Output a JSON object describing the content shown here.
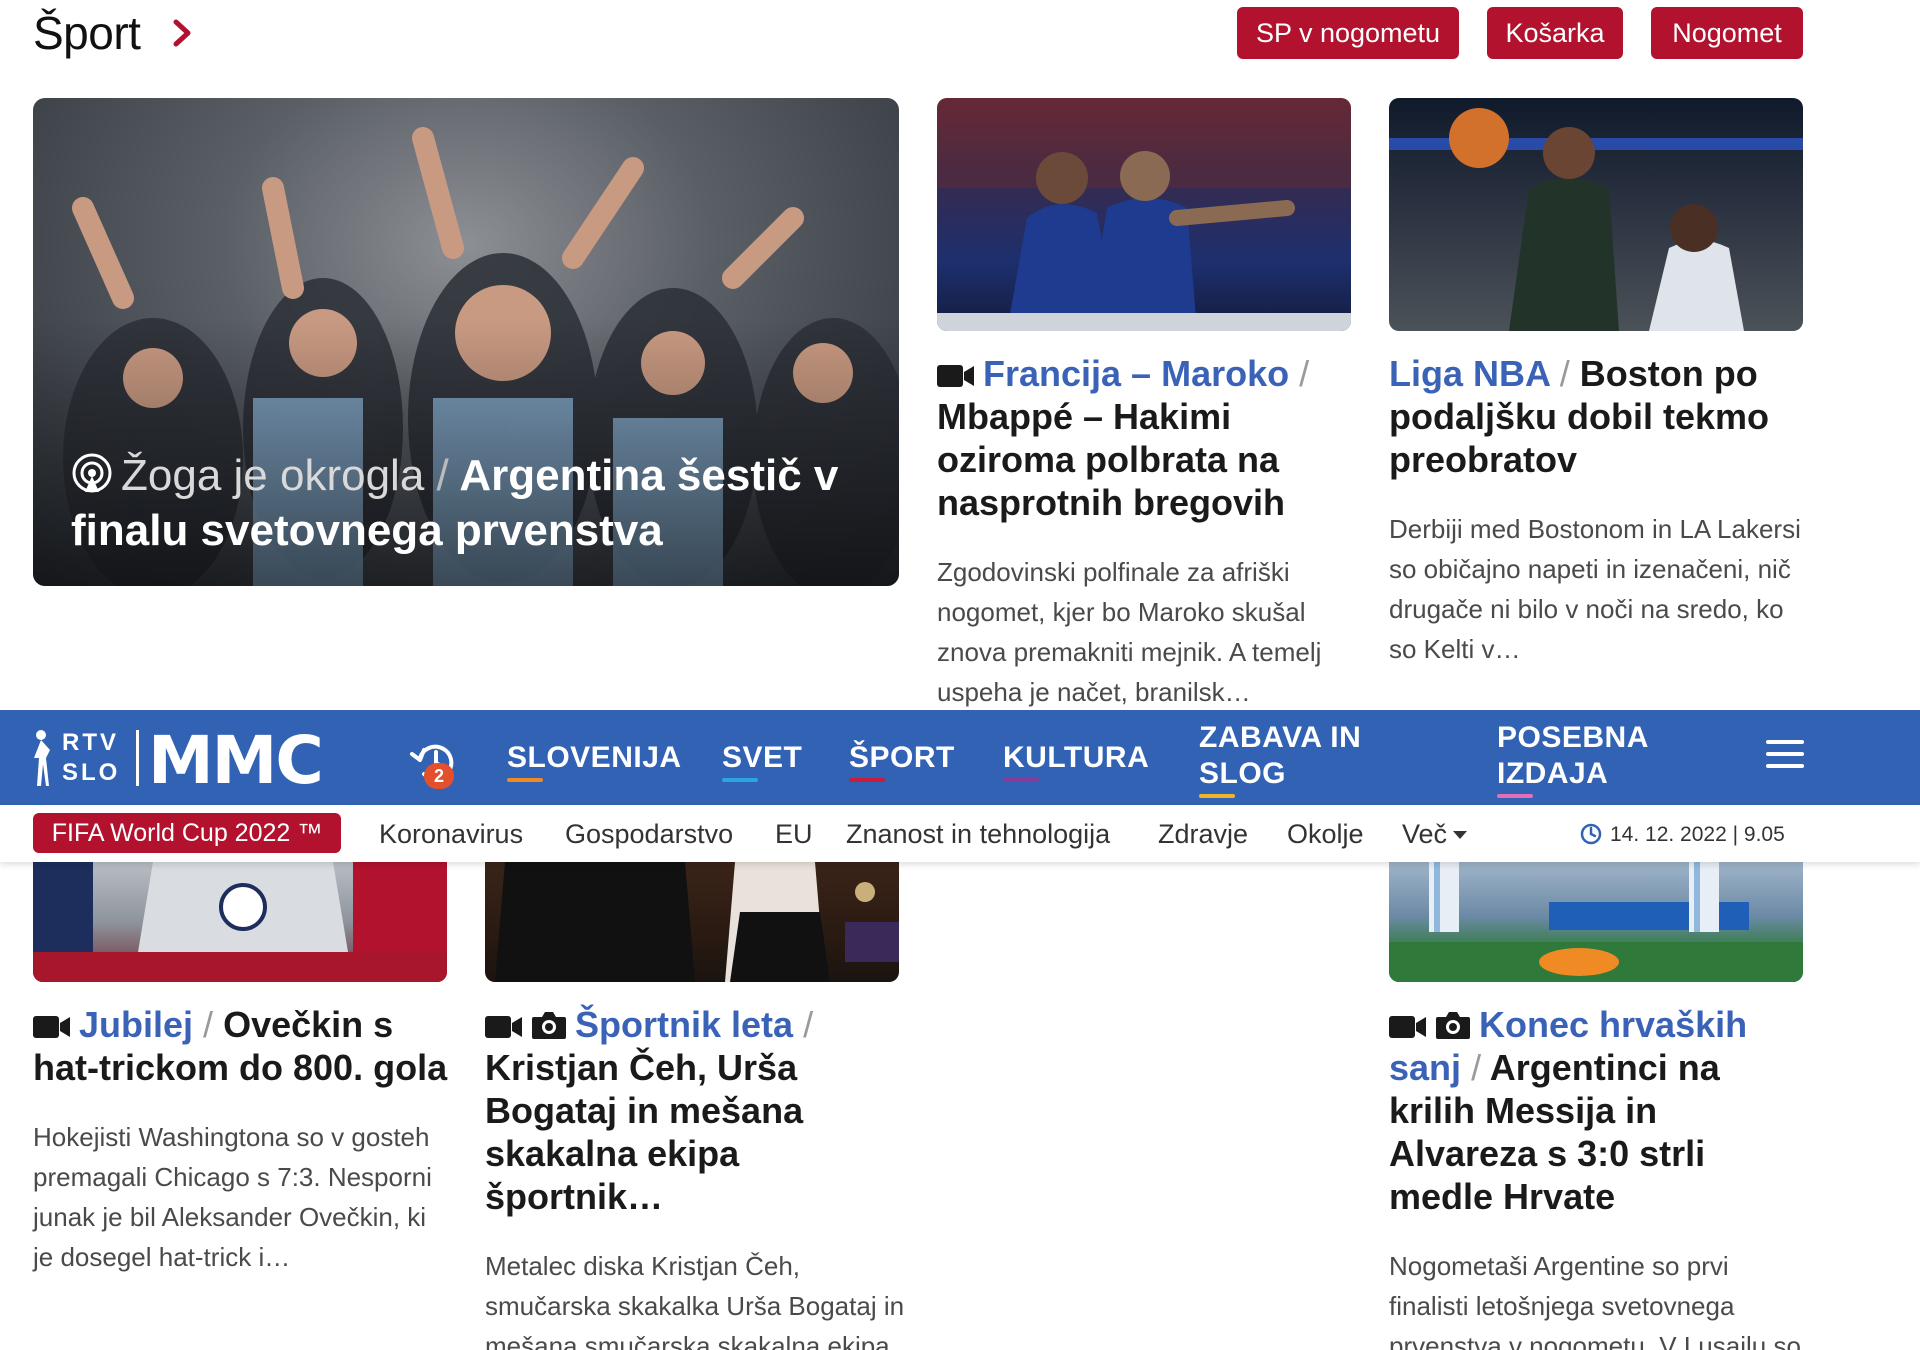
{
  "section": {
    "title": "Šport",
    "chips": [
      "SP v nogometu",
      "Košarka",
      "Nogomet"
    ]
  },
  "hero": {
    "kicker": "Žoga je okrogla",
    "separator": "/",
    "title": "Argentina šestič v finalu svetovnega prvenstva",
    "icon": "podcast-icon"
  },
  "articles": [
    {
      "kicker": "Francija – Maroko",
      "separator": "/",
      "title": "Mbappé – Hakimi oziroma polbrata na nasprotnih bregovih",
      "desc": "Zgodovinski polfinale za afriški nogomet, kjer bo Maroko skušal znova premakniti mejnik. A temelj uspeha je načet, branilsk…",
      "icons": [
        "video-icon"
      ]
    },
    {
      "kicker": "Liga NBA",
      "separator": "/",
      "title": "Boston po podaljšku dobil tekmo preobratov",
      "desc": "Derbiji med Bostonom in LA Lakersi so običajno napeti in izenačeni, nič drugače ni bilo v noči na sredo, ko so Kelti v…",
      "icons": []
    },
    {
      "kicker": "Jubilej",
      "separator": "/",
      "title": "Ovečkin s hat-trickom do 800. gola",
      "desc": "Hokejisti Washingtona so v gosteh premagali Chicago s 7:3. Nesporni junak je bil Aleksander Ovečkin, ki je dosegel hat-trick i…",
      "icons": [
        "video-icon"
      ]
    },
    {
      "kicker": "Športnik leta",
      "separator": "/",
      "title": "Kristjan Čeh, Urša Bogataj in mešana skakalna ekipa športnik…",
      "desc": "Metalec diska Kristjan Čeh, smučarska skakalka Urša Bogataj in mešana smučarska skakalna ekipa (Urša Bogataj, Nika Križna…",
      "icons": [
        "video-icon",
        "camera-icon"
      ]
    },
    {
      "kicker": "Konec hrvaških sanj",
      "separator": "/",
      "title": "Argentinci na krilih Messija in Alvareza s 3:0 strli medle Hrvate",
      "desc": "Nogometaši Argentine so prvi finalisti letošnjega svetovnega prvenstva v nogometu. V Lusailu so prepričljivo dobili polfinalni…",
      "icons": [
        "video-icon",
        "camera-icon"
      ]
    }
  ],
  "nav": {
    "logo_rtv": "RTV",
    "logo_slo": "SLO",
    "logo_mmc": "MMC",
    "history_badge": "2",
    "items": [
      {
        "label": "SLOVENIJA",
        "color": "#f08a24"
      },
      {
        "label": "SVET",
        "color": "#2aa5e0"
      },
      {
        "label": "ŠPORT",
        "color": "#c81e3c"
      },
      {
        "label": "KULTURA",
        "color": "#8a3a9a"
      },
      {
        "label": "ZABAVA IN SLOG",
        "color": "#f0b429"
      },
      {
        "label": "POSEBNA IZDAJA",
        "color": "#e36fb8"
      }
    ]
  },
  "subnav": {
    "highlight": "FIFA World Cup 2022 ™",
    "items": [
      "Koronavirus",
      "Gospodarstvo",
      "EU",
      "Znanost in tehnologija",
      "Zdravje",
      "Okolje",
      "Več"
    ],
    "date": "14. 12. 2022 | 9.05"
  },
  "colors": {
    "brand_red": "#b3122e",
    "nav_blue": "#3262b4",
    "kicker_blue": "#3a63b8"
  }
}
